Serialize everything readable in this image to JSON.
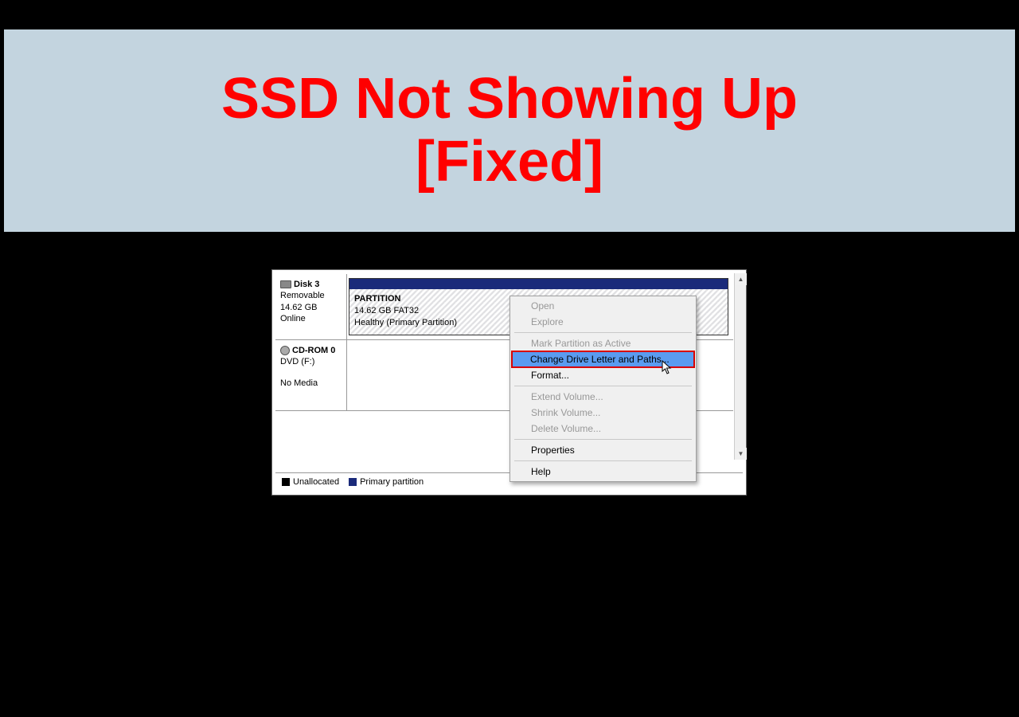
{
  "banner": {
    "title": "SSD Not Showing Up\n[Fixed]"
  },
  "disks": [
    {
      "name": "Disk 3",
      "type": "Removable",
      "size": "14.62 GB",
      "status": "Online",
      "partition": {
        "name": "PARTITION",
        "detail": "14.62 GB FAT32",
        "status": "Healthy (Primary Partition)"
      }
    },
    {
      "name": "CD-ROM 0",
      "type": "DVD (F:)",
      "status": "No Media"
    }
  ],
  "legend": {
    "unallocated": "Unallocated",
    "primary": "Primary partition"
  },
  "context_menu": {
    "items": [
      {
        "label": "Open",
        "enabled": false
      },
      {
        "label": "Explore",
        "enabled": false
      },
      {
        "sep": true
      },
      {
        "label": "Mark Partition as Active",
        "enabled": false
      },
      {
        "label": "Change Drive Letter and Paths...",
        "enabled": true,
        "highlighted": true
      },
      {
        "label": "Format...",
        "enabled": true
      },
      {
        "sep": true
      },
      {
        "label": "Extend Volume...",
        "enabled": false
      },
      {
        "label": "Shrink Volume...",
        "enabled": false
      },
      {
        "label": "Delete Volume...",
        "enabled": false
      },
      {
        "sep": true
      },
      {
        "label": "Properties",
        "enabled": true
      },
      {
        "sep": true
      },
      {
        "label": "Help",
        "enabled": true
      }
    ]
  }
}
